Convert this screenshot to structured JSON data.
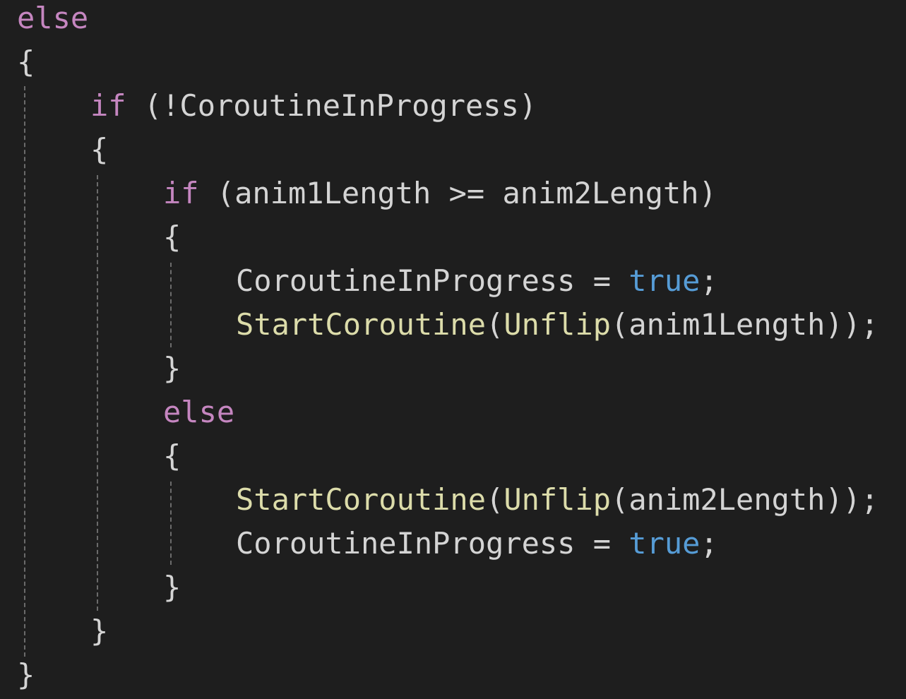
{
  "code": {
    "lines": [
      [
        {
          "t": "else",
          "k": "kw-ctrl"
        }
      ],
      [
        {
          "t": "{",
          "k": "txt"
        }
      ],
      [
        {
          "t": "if",
          "k": "kw-ctrl"
        },
        {
          "t": " (!CoroutineInProgress)",
          "k": "txt"
        }
      ],
      [
        {
          "t": "{",
          "k": "txt"
        }
      ],
      [
        {
          "t": "if",
          "k": "kw-ctrl"
        },
        {
          "t": " (anim1Length >= anim2Length)",
          "k": "txt"
        }
      ],
      [
        {
          "t": "{",
          "k": "txt"
        }
      ],
      [
        {
          "t": "CoroutineInProgress = ",
          "k": "txt"
        },
        {
          "t": "true",
          "k": "kw"
        },
        {
          "t": ";",
          "k": "txt"
        }
      ],
      [
        {
          "t": "StartCoroutine",
          "k": "fn"
        },
        {
          "t": "(",
          "k": "txt"
        },
        {
          "t": "Unflip",
          "k": "fn"
        },
        {
          "t": "(anim1Length));",
          "k": "txt"
        }
      ],
      [
        {
          "t": "}",
          "k": "txt"
        }
      ],
      [
        {
          "t": "else",
          "k": "kw-ctrl"
        }
      ],
      [
        {
          "t": "{",
          "k": "txt"
        }
      ],
      [
        {
          "t": "StartCoroutine",
          "k": "fn"
        },
        {
          "t": "(",
          "k": "txt"
        },
        {
          "t": "Unflip",
          "k": "fn"
        },
        {
          "t": "(anim2Length));",
          "k": "txt"
        }
      ],
      [
        {
          "t": "CoroutineInProgress = ",
          "k": "txt"
        },
        {
          "t": "true",
          "k": "kw"
        },
        {
          "t": ";",
          "k": "txt"
        }
      ],
      [
        {
          "t": "}",
          "k": "txt"
        }
      ],
      [
        {
          "t": "}",
          "k": "txt"
        }
      ],
      [
        {
          "t": "}",
          "k": "txt"
        }
      ]
    ]
  },
  "colors": {
    "background": "#1e1e1e",
    "control_keyword": "#c586c0",
    "keyword": "#569cd6",
    "function": "#dcdcaa",
    "text": "#d4d4d4",
    "indent_guide": "#6b6b6b"
  }
}
